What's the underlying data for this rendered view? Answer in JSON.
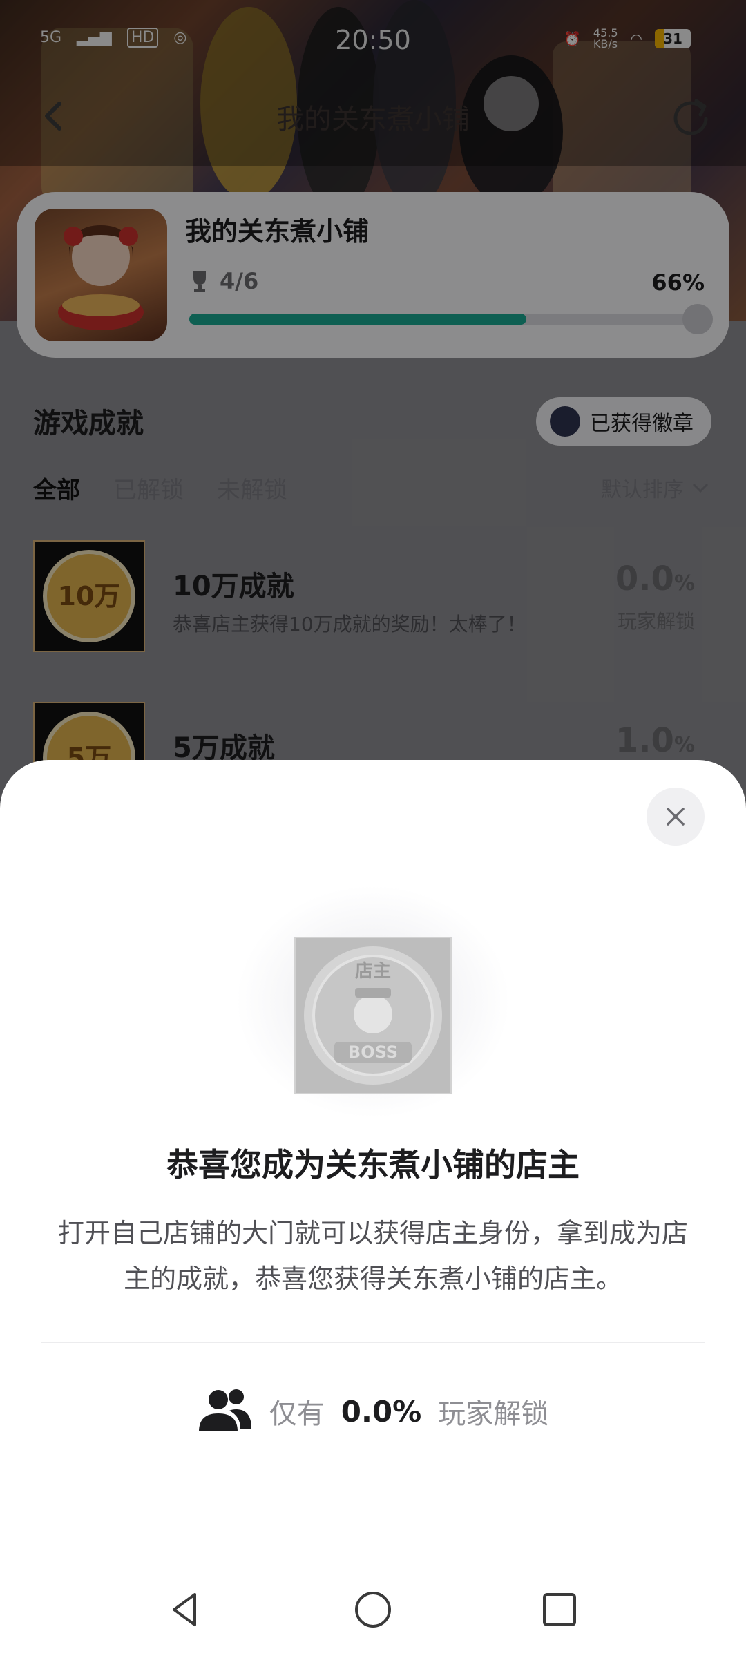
{
  "status_bar": {
    "network": "5G",
    "hd_label": "HD",
    "time": "20:50",
    "speed": "45.5",
    "speed_unit": "KB/s",
    "battery": "31"
  },
  "header": {
    "title": "我的关东煮小铺"
  },
  "game_card": {
    "name": "我的关东煮小铺",
    "trophies": "4/6",
    "percent": "66%",
    "progress_fraction": 0.66
  },
  "achievements_section": {
    "title": "游戏成就",
    "badge_button": "已获得徽章",
    "filters": [
      "全部",
      "已解锁",
      "未解锁"
    ],
    "sort_label": "默认排序",
    "items": [
      {
        "thumb_text": "10万",
        "title": "10万成就",
        "description": "恭喜店主获得10万成就的奖励！太棒了！",
        "percent_value": "0.0",
        "percent_sign": "%",
        "sub": "玩家解锁"
      },
      {
        "thumb_text": "5万",
        "title": "5万成就",
        "description": "",
        "percent_value": "1.0",
        "percent_sign": "%",
        "sub": ""
      }
    ]
  },
  "sheet": {
    "badge_top_text": "店主",
    "badge_bottom_text": "BOSS",
    "title": "恭喜您成为关东煮小铺的店主",
    "description": "打开自己店铺的大门就可以获得店主身份，拿到成为店主的成就，恭喜您获得关东煮小铺的店主。",
    "unlock_prefix": "仅有",
    "unlock_value": "0.0%",
    "unlock_suffix": "玩家解锁"
  },
  "colors": {
    "progress": "#1aa890",
    "sheet_bg": "#ffffff",
    "dim_overlay": "rgba(0,0,0,0.43)"
  }
}
